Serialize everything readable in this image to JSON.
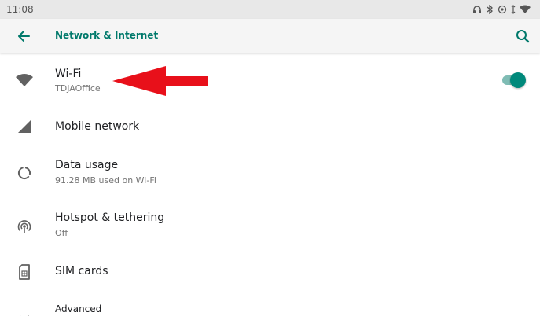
{
  "status_bar": {
    "time": "11:08",
    "icons": [
      "headset-icon",
      "bluetooth-icon",
      "location-icon",
      "data-arrows-icon",
      "wifi-signal-icon"
    ]
  },
  "app_bar": {
    "title": "Network & Internet",
    "back_icon": "arrow-back-icon",
    "search_icon": "search-icon"
  },
  "settings": {
    "items": [
      {
        "title": "Wi-Fi",
        "subtitle": "TDJAOffice",
        "icon": "wifi-icon",
        "toggle_on": true
      },
      {
        "title": "Mobile network",
        "icon": "cell-signal-icon"
      },
      {
        "title": "Data usage",
        "subtitle": "91.28 MB used on Wi-Fi",
        "icon": "data-usage-icon"
      },
      {
        "title": "Hotspot & tethering",
        "subtitle": "Off",
        "icon": "hotspot-icon"
      },
      {
        "title": "SIM cards",
        "icon": "sim-card-icon"
      },
      {
        "title": "Advanced",
        "icon": "chevron-down-icon"
      }
    ]
  },
  "colors": {
    "accent": "#00796b",
    "toggle_thumb": "#00897b",
    "toggle_track": "#7fbcb4",
    "annotation_arrow": "#e8101a"
  }
}
